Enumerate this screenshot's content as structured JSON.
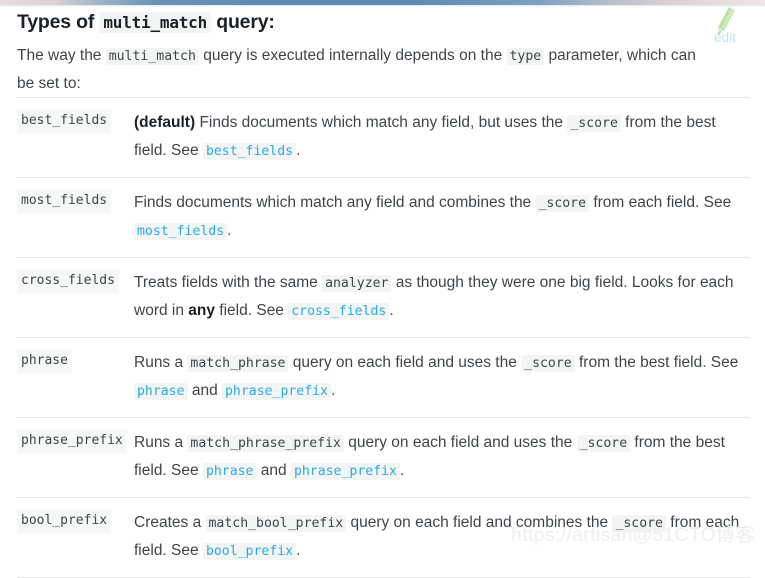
{
  "top_strip": {
    "gradient_left": "#e9dcdc",
    "gradient_mid": "#5d8cb4",
    "gradient_right": "#efe7e6"
  },
  "colors": {
    "text": "#3f4549",
    "heading": "#1c2126",
    "link": "#29abe2",
    "code_bg": "#f3f4f4",
    "rule": "#e6e8e8",
    "pencil": "#c7e6b8",
    "edit_label": "#bfe3f5",
    "watermark": "#eceeef"
  },
  "heading": {
    "before": "Types of ",
    "code": "multi_match",
    "after": " query:"
  },
  "intro": {
    "part1": "The way the ",
    "code1": "multi_match",
    "part2": " query is executed internally depends on the ",
    "code2": "type",
    "part3": " parameter, which can be set to:"
  },
  "edit_control": {
    "icon": "pencil-icon",
    "label": "edit"
  },
  "watermark": {
    "text": "https://artisan@51CTO博客"
  },
  "types_table": {
    "rows": [
      {
        "term": "best_fields",
        "segments": [
          {
            "kind": "bold",
            "text": "(default)"
          },
          {
            "kind": "text",
            "text": " Finds documents which match any field, but uses the "
          },
          {
            "kind": "code",
            "text": "_score"
          },
          {
            "kind": "text",
            "text": " from the best field. See "
          },
          {
            "kind": "link",
            "text": "best_fields"
          },
          {
            "kind": "text",
            "text": "."
          }
        ]
      },
      {
        "term": "most_fields",
        "segments": [
          {
            "kind": "text",
            "text": "Finds documents which match any field and combines the "
          },
          {
            "kind": "code",
            "text": "_score"
          },
          {
            "kind": "text",
            "text": " from each field. See "
          },
          {
            "kind": "link",
            "text": "most_fields"
          },
          {
            "kind": "text",
            "text": "."
          }
        ]
      },
      {
        "term": "cross_fields",
        "segments": [
          {
            "kind": "text",
            "text": "Treats fields with the same "
          },
          {
            "kind": "code",
            "text": "analyzer"
          },
          {
            "kind": "text",
            "text": " as though they were one big field. Looks for each word in "
          },
          {
            "kind": "bold",
            "text": "any"
          },
          {
            "kind": "text",
            "text": " field. See "
          },
          {
            "kind": "link",
            "text": "cross_fields"
          },
          {
            "kind": "text",
            "text": "."
          }
        ]
      },
      {
        "term": "phrase",
        "segments": [
          {
            "kind": "text",
            "text": "Runs a "
          },
          {
            "kind": "code",
            "text": "match_phrase"
          },
          {
            "kind": "text",
            "text": " query on each field and uses the "
          },
          {
            "kind": "code",
            "text": "_score"
          },
          {
            "kind": "text",
            "text": " from the best field. See "
          },
          {
            "kind": "link",
            "text": "phrase"
          },
          {
            "kind": "text",
            "text": " and "
          },
          {
            "kind": "link",
            "text": "phrase_prefix"
          },
          {
            "kind": "text",
            "text": "."
          }
        ]
      },
      {
        "term": "phrase_prefix",
        "segments": [
          {
            "kind": "text",
            "text": "Runs a "
          },
          {
            "kind": "code",
            "text": "match_phrase_prefix"
          },
          {
            "kind": "text",
            "text": " query on each field and uses the "
          },
          {
            "kind": "code",
            "text": "_score"
          },
          {
            "kind": "text",
            "text": " from the best field. See "
          },
          {
            "kind": "link",
            "text": "phrase"
          },
          {
            "kind": "text",
            "text": " and "
          },
          {
            "kind": "link",
            "text": "phrase_prefix"
          },
          {
            "kind": "text",
            "text": "."
          }
        ]
      },
      {
        "term": "bool_prefix",
        "segments": [
          {
            "kind": "text",
            "text": "Creates a "
          },
          {
            "kind": "code",
            "text": "match_bool_prefix"
          },
          {
            "kind": "text",
            "text": " query on each field and combines the "
          },
          {
            "kind": "code",
            "text": "_score"
          },
          {
            "kind": "text",
            "text": " from each field. See "
          },
          {
            "kind": "link",
            "text": "bool_prefix"
          },
          {
            "kind": "text",
            "text": "."
          }
        ]
      }
    ]
  }
}
